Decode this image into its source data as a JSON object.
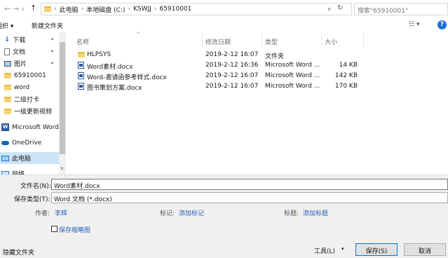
{
  "address": {
    "back_glyph": "←",
    "forward_glyph": "→",
    "recent_glyph": "∨",
    "up_glyph": "↑",
    "crumbs": [
      "此电脑",
      "本地磁盘 (C:)",
      "KSWJJ",
      "65910001"
    ],
    "separator": "›",
    "dropdown_glyph": "∨",
    "refresh_glyph": "↻",
    "search_placeholder": "搜索\"65910001\""
  },
  "toolbar": {
    "organize": "组织 ▾",
    "new_folder": "新建文件夹",
    "view_glyph": "☷ ▾",
    "help_glyph": "?"
  },
  "sidebar": {
    "items": [
      {
        "label": "下载",
        "icon": "download-icon",
        "pin": "📌"
      },
      {
        "label": "文档",
        "icon": "document-icon",
        "pin": "📌"
      },
      {
        "label": "图片",
        "icon": "picture-icon",
        "pin": "📌"
      },
      {
        "label": "65910001",
        "icon": "folder-icon"
      },
      {
        "label": "word",
        "icon": "folder-icon"
      },
      {
        "label": "二级打卡",
        "icon": "folder-icon"
      },
      {
        "label": "一级更新视频",
        "icon": "folder-icon"
      },
      {
        "label": "Microsoft Word",
        "icon": "word-icon"
      },
      {
        "label": "OneDrive",
        "icon": "cloud-icon"
      },
      {
        "label": "此电脑",
        "icon": "computer-icon"
      },
      {
        "label": "网络",
        "icon": "network-icon"
      }
    ]
  },
  "columns": {
    "name": "名称",
    "modified": "修改日期",
    "type": "类型",
    "size": "大小",
    "sort_glyph": "^"
  },
  "files": [
    {
      "name": "HLPSYS",
      "modified": "2019-2-12 16:07",
      "type": "文件夹",
      "size": "",
      "kind": "folder"
    },
    {
      "name": "Word素材.docx",
      "modified": "2019-2-12 16:36",
      "type": "Microsoft Word ...",
      "size": "14 KB",
      "kind": "doc"
    },
    {
      "name": "Word-邀请函参考样式.docx",
      "modified": "2019-2-12 16:07",
      "type": "Microsoft Word ...",
      "size": "142 KB",
      "kind": "doc"
    },
    {
      "name": "图书策划方案.docx",
      "modified": "2019-2-12 16:07",
      "type": "Microsoft Word ...",
      "size": "170 KB",
      "kind": "doc"
    }
  ],
  "save": {
    "filename_label": "文件名(N):",
    "filename_value": "Word素材.docx",
    "type_label": "保存类型(T):",
    "type_value": "Word 文档 (*.docx)",
    "author_label": "作者:",
    "author_value": "李辉",
    "tags_label": "标记:",
    "tags_value": "添加标记",
    "title_label": "标题:",
    "title_value": "添加标题",
    "thumbnail_label": "保存缩略图",
    "hide_folders": "隐藏文件夹",
    "tools": "工具(L)",
    "tools_glyph": "▾",
    "save_button": "保存(S)",
    "cancel_button": "取消"
  }
}
